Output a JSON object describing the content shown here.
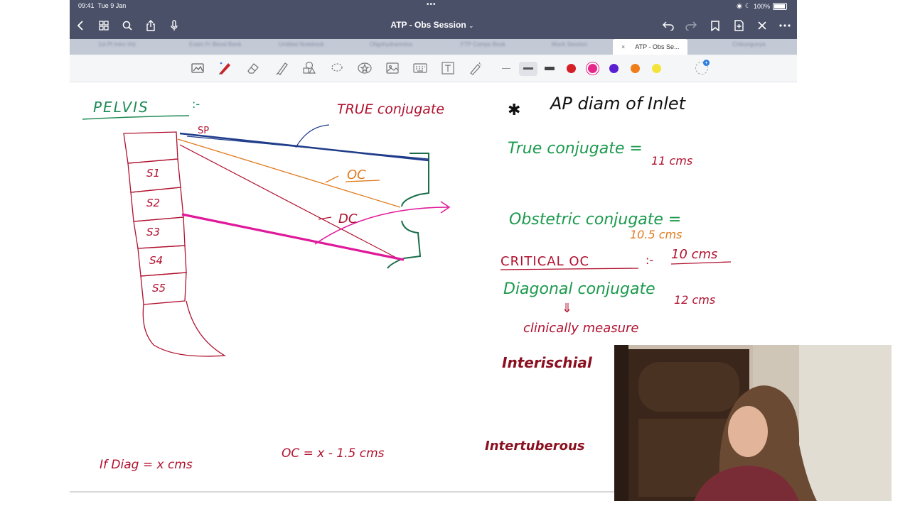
{
  "status": {
    "time": "09:41",
    "date": "Tue 9 Jan",
    "battery": "100%"
  },
  "header": {
    "title": "ATP - Obs Session",
    "title_chevron": "⌄"
  },
  "tabs": [
    {
      "label": "1st Pt Intro Vid"
    },
    {
      "label": "Exam Fr Blood Bank"
    },
    {
      "label": "Untitled Notebook"
    },
    {
      "label": "Oligohydramnios"
    },
    {
      "label": "FTP Comps Book"
    },
    {
      "label": "Mock Session"
    },
    {
      "label": "ATP - Obs Se..."
    },
    {
      "label": "Chikungunya"
    }
  ],
  "active_tab_index": 6,
  "active_tab_close": "×",
  "icons": {
    "back": "chevron-left-icon",
    "grid": "grid-icon",
    "search": "search-icon",
    "share": "share-icon",
    "mic": "mic-icon",
    "undo": "undo-icon",
    "redo": "redo-icon",
    "bookmark": "bookmark-icon",
    "add_page": "add-page-icon",
    "close": "close-icon",
    "more": "more-icon"
  },
  "toolbar": {
    "tools": [
      "image-snip-icon",
      "pen-icon",
      "eraser-icon",
      "highlighter-icon",
      "shapes-icon",
      "lasso-icon",
      "star-icon",
      "image-icon",
      "keyboard-icon",
      "text-icon",
      "laser-icon"
    ],
    "colors": [
      "#d41f26",
      "#e6288a",
      "#5a1fd0",
      "#f07d1a",
      "#f4e43a"
    ]
  },
  "notes": {
    "title": "PELVIS",
    "title_suffix": ":-",
    "sp": "SP",
    "segments": [
      "S1",
      "S2",
      "S3",
      "S4",
      "S5"
    ],
    "oc_label": "OC",
    "dc_label": "DC",
    "true_conj_label": "TRUE conjugate",
    "heading": "AP diam of Inlet",
    "star": "✱",
    "true_conj": "True conjugate =",
    "true_conj_val": "11 cms",
    "obst_conj": "Obstetric conjugate =",
    "obst_conj_val": "10.5 cms",
    "critical_oc": "CRITICAL OC",
    "critical_sep": ":-",
    "critical_val": "10 cms",
    "diag_conj": "Diagonal conjugate",
    "diag_val": "12 cms",
    "arrow_down": "⇓",
    "clinically": "clinically measure",
    "interischial": "Interischial",
    "intertuberous": "Intertuberous",
    "formula1": "If Diag = x cms",
    "formula2": "OC = x - 1.5 cms"
  }
}
